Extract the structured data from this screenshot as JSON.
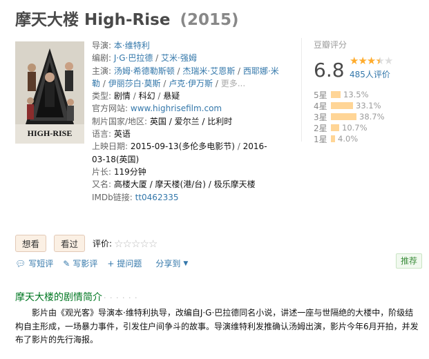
{
  "title": {
    "cn": "摩天大楼",
    "en": "High-Rise",
    "year": "(2015)"
  },
  "poster": {
    "caption": "HIGH-RISE"
  },
  "info": {
    "director": {
      "label": "导演",
      "names": [
        "本·维特利"
      ]
    },
    "writer": {
      "label": "编剧",
      "names": [
        "J·G·巴拉德",
        "艾米·强姆"
      ]
    },
    "cast": {
      "label": "主演",
      "names": [
        "汤姆·希德勒斯顿",
        "杰瑞米·艾恩斯",
        "西耶娜·米勒",
        "伊丽莎白·莫斯",
        "卢克·伊万斯"
      ],
      "more": "更多..."
    },
    "genre": {
      "label": "类型:",
      "values": [
        "剧情",
        "科幻",
        "悬疑"
      ]
    },
    "website": {
      "label": "官方网站:",
      "value": "www.highrisefilm.com"
    },
    "country": {
      "label": "制片国家/地区:",
      "value": "英国 / 爱尔兰 / 比利时"
    },
    "language": {
      "label": "语言:",
      "value": "英语"
    },
    "release": {
      "label": "上映日期:",
      "value1": "2015-09-13(多伦多电影节)",
      "sep": " / ",
      "value2": "2016-03-18(英国)"
    },
    "runtime": {
      "label": "片长:",
      "value": "119分钟"
    },
    "aka": {
      "label": "又名:",
      "value": "高楼大厦 / 摩天楼(港/台) / 极乐摩天楼"
    },
    "imdb": {
      "label": "IMDb链接:",
      "value": "tt0462335"
    }
  },
  "rating": {
    "title": "豆瓣评分",
    "score": "6.8",
    "stars_full": 3,
    "stars_half": 1,
    "votes": "485人评价",
    "distribution": [
      {
        "label": "5星",
        "pct": "13.5%",
        "value": 13.5
      },
      {
        "label": "4星",
        "pct": "33.1%",
        "value": 33.1
      },
      {
        "label": "3星",
        "pct": "38.7%",
        "value": 38.7
      },
      {
        "label": "2星",
        "pct": "10.7%",
        "value": 10.7
      },
      {
        "label": "1星",
        "pct": "4.0%",
        "value": 4.0
      }
    ]
  },
  "actions": {
    "want": "想看",
    "seen": "看过",
    "rate_label": "评价:"
  },
  "tools": {
    "short_review": "写短评",
    "review": "写影评",
    "question": "提问题",
    "share": "分享到"
  },
  "recommend": "推荐",
  "summary": {
    "heading": "摩天大楼的剧情简介",
    "dots": "· · · · · ·",
    "text": "影片由《观光客》导演本·维特利执导，改编自J·G·巴拉德同名小说，讲述一座与世隔绝的大楼中，阶级结构自主形成，一场暴力事件，引发住户间争斗的故事。导演维特利发推确认汤姆出演，影片今年6月开拍，并发布了影片的先行海报。"
  },
  "colors": {
    "link": "#3377aa",
    "star": "#ffac2d",
    "bar": "#ffd596",
    "heading": "#007722"
  }
}
